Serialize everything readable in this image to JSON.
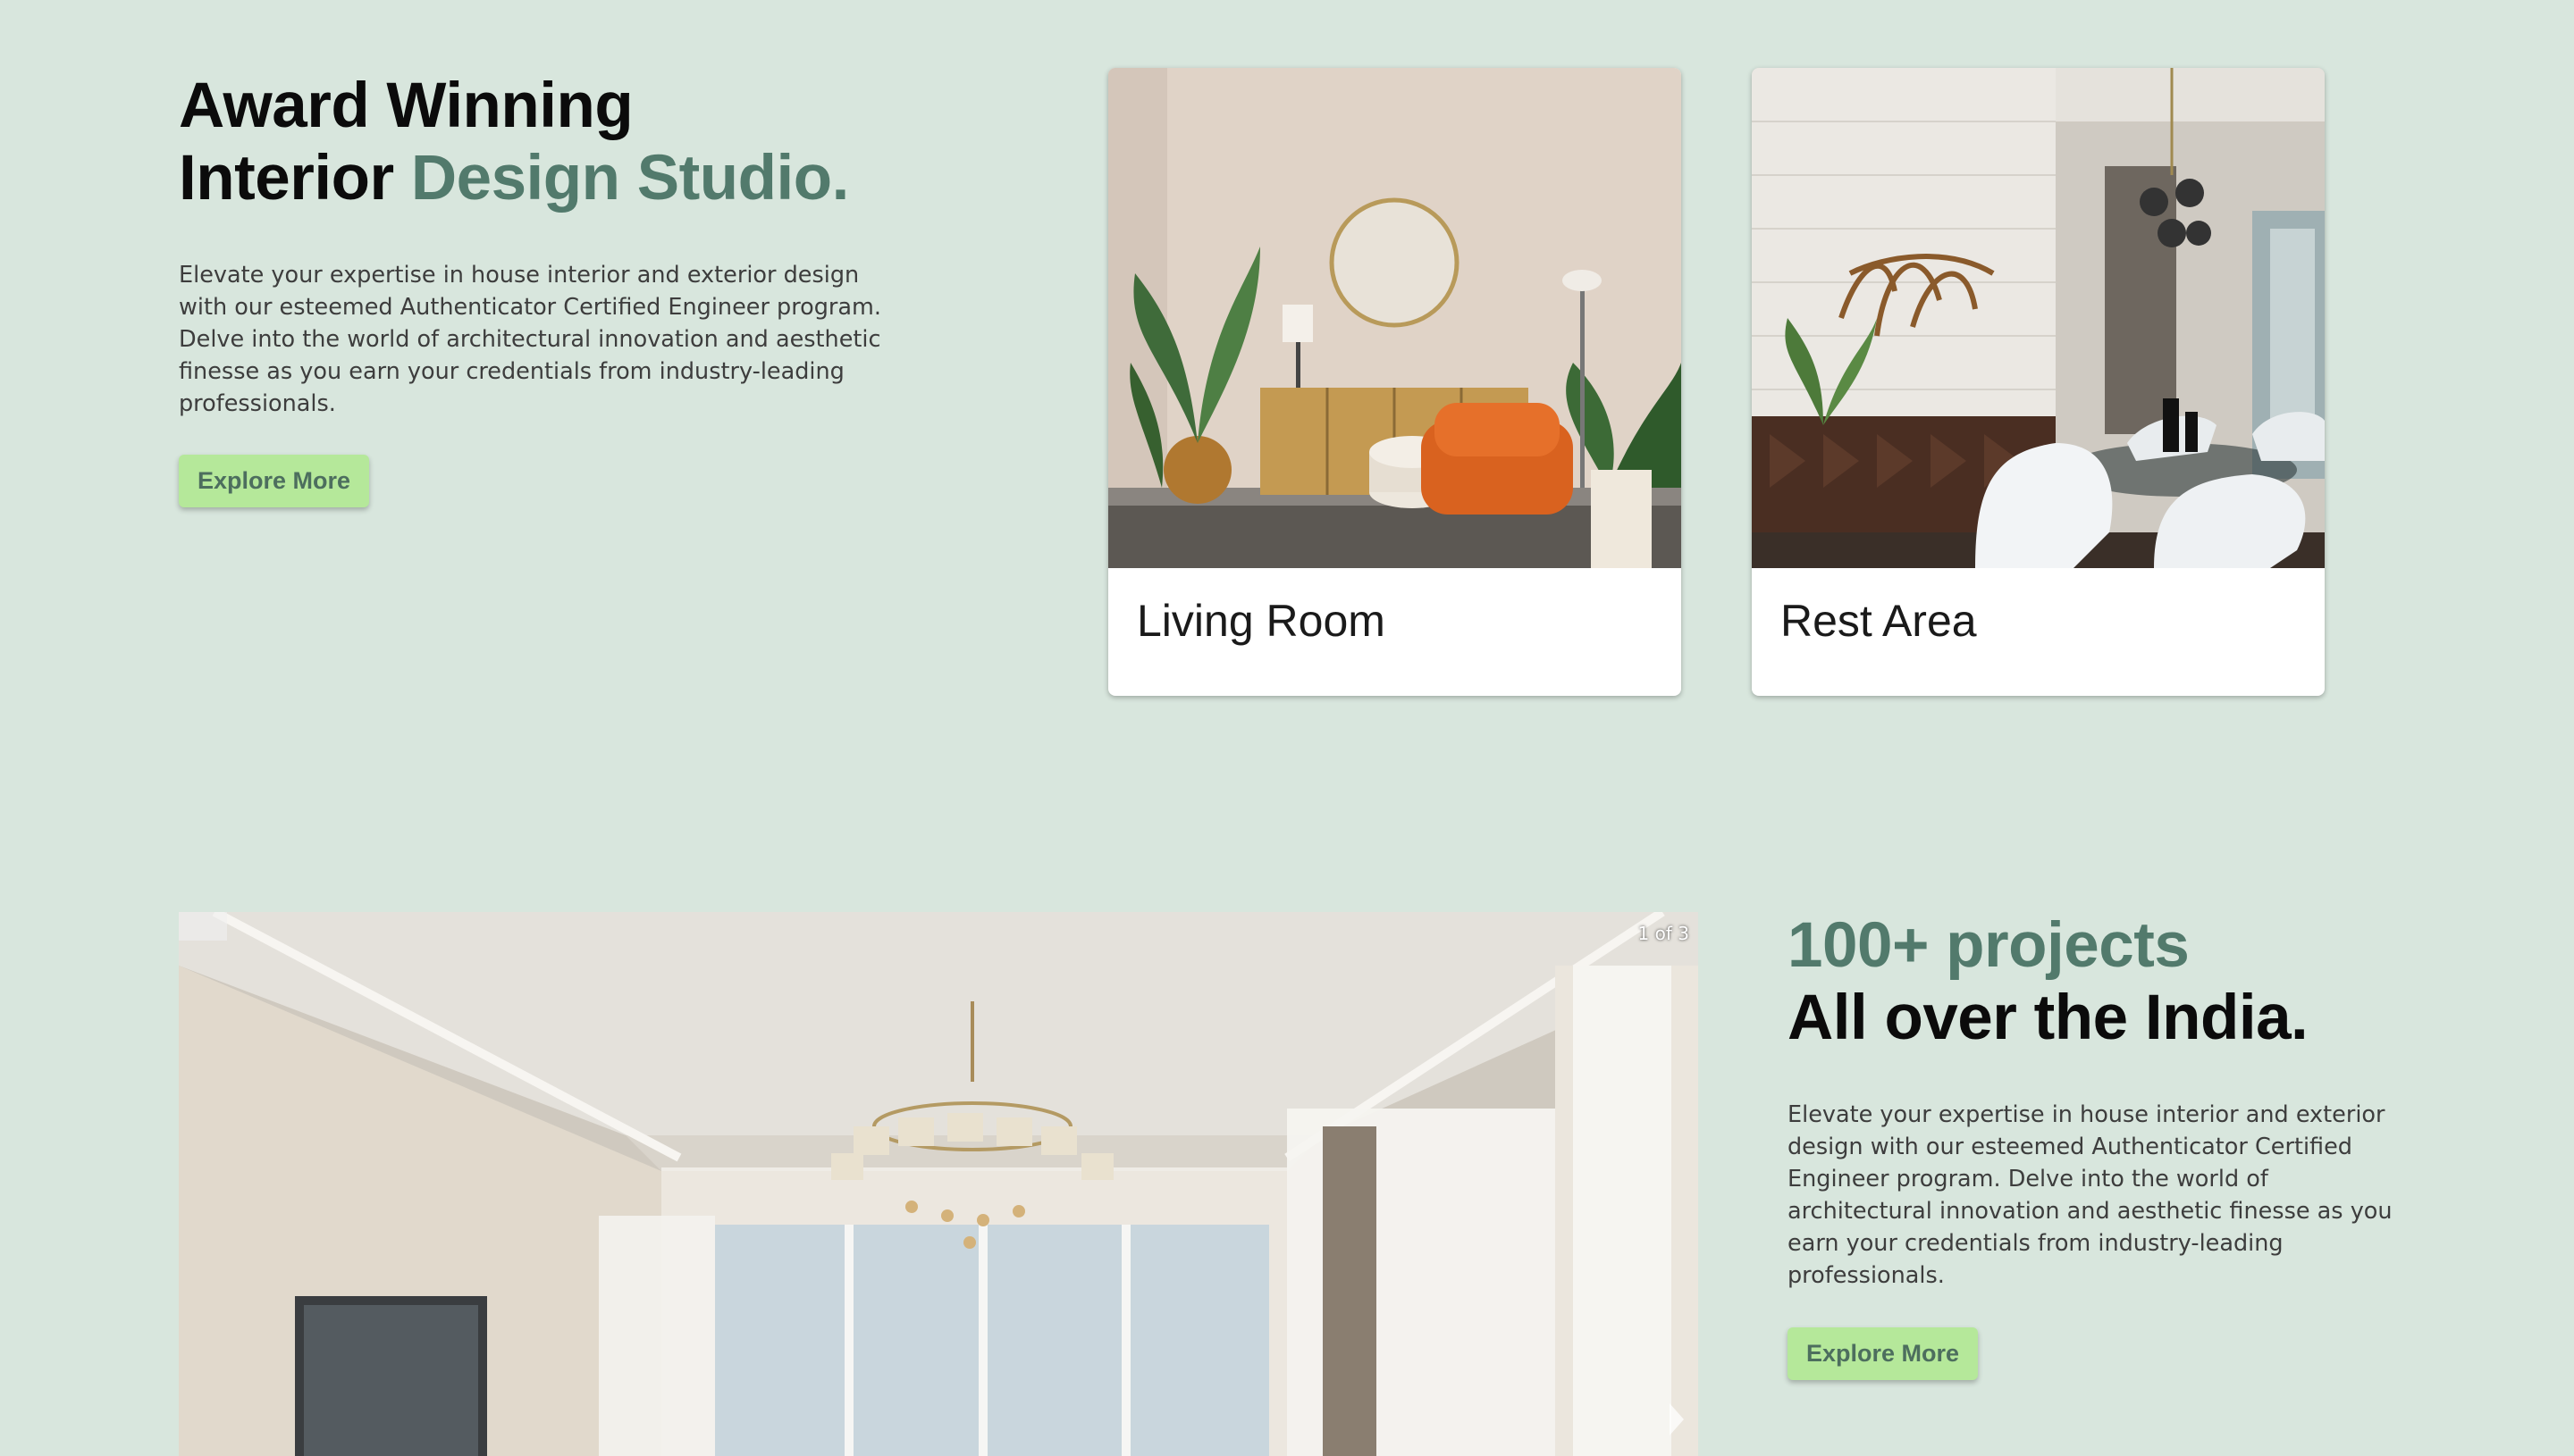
{
  "hero": {
    "title_line1": "Award Winning",
    "title_line2_dark": "Interior ",
    "title_line2_accent": "Design Studio.",
    "description": "Elevate your expertise in house interior and exterior design with our esteemed Authenticator Certified Engineer program. Delve into the world of architectural innovation and aesthetic finesse as you earn your credentials from industry-leading professionals.",
    "button_label": "Explore More"
  },
  "cards": [
    {
      "label": "Living Room"
    },
    {
      "label": "Rest Area"
    }
  ],
  "carousel": {
    "counter": "1 of 3"
  },
  "projects": {
    "title_accent": "100+ projects",
    "title_dark": "All over the India.",
    "description": "Elevate your expertise in house interior and exterior design with our esteemed Authenticator Certified Engineer program. Delve into the world of architectural innovation and aesthetic finesse as you earn your credentials from industry-leading professionals.",
    "button_label": "Explore More"
  },
  "colors": {
    "background": "#d8e6dd",
    "accent_text": "#527a6c",
    "button_bg": "#b5e89a",
    "button_text": "#4d6e5e"
  }
}
